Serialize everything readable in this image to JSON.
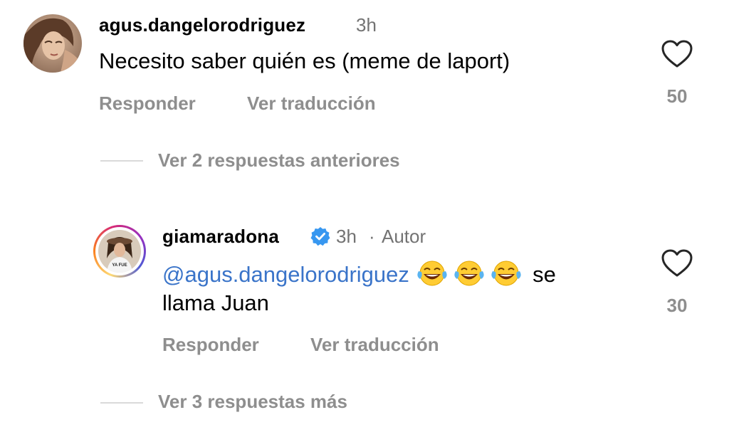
{
  "comments": [
    {
      "username": "agus.dangelorodriguez",
      "time": "3h",
      "text": "Necesito saber quién es (meme de laport)",
      "reply_label": "Responder",
      "translate_label": "Ver traducción",
      "likes": "50",
      "view_replies": "Ver 2 respuestas anteriores"
    },
    {
      "username": "giamaradona",
      "verified": true,
      "time": "3h",
      "separator": "·",
      "author_label": "Autor",
      "mention": "@agus.dangelorodriguez",
      "text_after_emojis": "se",
      "text_line2": "llama Juan",
      "reply_label": "Responder",
      "translate_label": "Ver traducción",
      "likes": "30",
      "view_more_replies": "Ver 3 respuestas más",
      "avatar_shirt_text": "YA FUE"
    }
  ],
  "icons": {
    "heart": "heart-outline-icon",
    "verified": "verified-badge-icon",
    "emoji": "face-with-tears-of-joy-emoji"
  },
  "colors": {
    "mention": "#3a74c9",
    "secondary_text": "#8e8e8e",
    "verified": "#3797f0"
  }
}
